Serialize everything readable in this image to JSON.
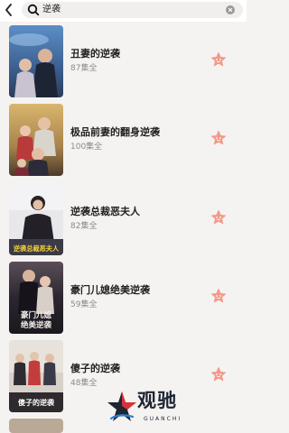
{
  "search": {
    "query": "逆袭"
  },
  "results": [
    {
      "title": "丑妻的逆袭",
      "episodes": "87集全",
      "poster_text": ""
    },
    {
      "title": "极品前妻的翻身逆袭",
      "episodes": "100集全",
      "poster_text": ""
    },
    {
      "title": "逆袭总裁恶夫人",
      "episodes": "82集全",
      "poster_text": "逆袭总裁恶夫人"
    },
    {
      "title": "豪门儿媳绝美逆袭",
      "episodes": "59集全",
      "poster_text": "豪门儿媳绝美逆袭"
    },
    {
      "title": "傻子的逆袭",
      "episodes": "48集全",
      "poster_text": "傻子的逆袭"
    }
  ],
  "watermark": {
    "text": "观驰",
    "subtext": "GUANCHI"
  },
  "colors": {
    "accent_star": "#f29a8a",
    "background": "#f5f3f1"
  }
}
